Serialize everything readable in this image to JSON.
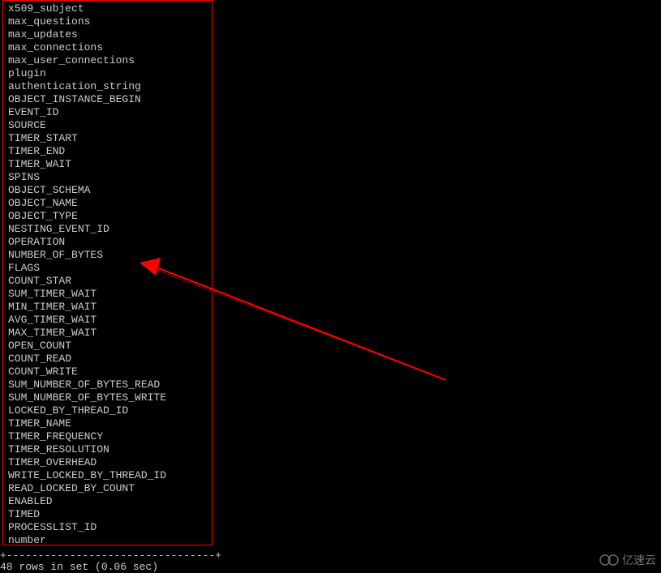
{
  "terminal": {
    "columns": [
      "x509_subject",
      "max_questions",
      "max_updates",
      "max_connections",
      "max_user_connections",
      "plugin",
      "authentication_string",
      "OBJECT_INSTANCE_BEGIN",
      "EVENT_ID",
      "SOURCE",
      "TIMER_START",
      "TIMER_END",
      "TIMER_WAIT",
      "SPINS",
      "OBJECT_SCHEMA",
      "OBJECT_NAME",
      "OBJECT_TYPE",
      "NESTING_EVENT_ID",
      "OPERATION",
      "NUMBER_OF_BYTES",
      "FLAGS",
      "COUNT_STAR",
      "SUM_TIMER_WAIT",
      "MIN_TIMER_WAIT",
      "AVG_TIMER_WAIT",
      "MAX_TIMER_WAIT",
      "OPEN_COUNT",
      "COUNT_READ",
      "COUNT_WRITE",
      "SUM_NUMBER_OF_BYTES_READ",
      "SUM_NUMBER_OF_BYTES_WRITE",
      "LOCKED_BY_THREAD_ID",
      "TIMER_NAME",
      "TIMER_FREQUENCY",
      "TIMER_RESOLUTION",
      "TIMER_OVERHEAD",
      "WRITE_LOCKED_BY_THREAD_ID",
      "READ_LOCKED_BY_COUNT",
      "ENABLED",
      "TIMED",
      "PROCESSLIST_ID",
      "number"
    ],
    "separator": "+---------------------------------+",
    "result_text": "48 rows in set (0.06 sec)"
  },
  "watermark": {
    "text": "亿速云"
  }
}
